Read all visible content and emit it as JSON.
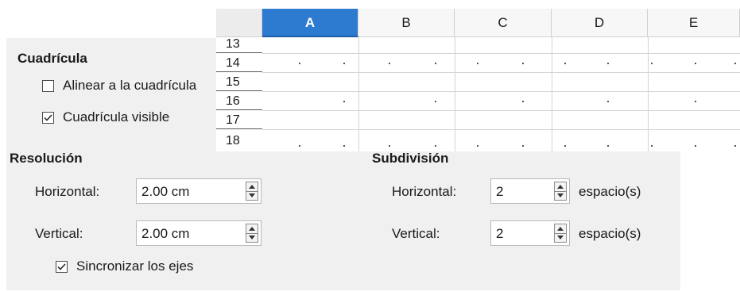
{
  "grid_section": {
    "title": "Cuadrícula",
    "snap_to_grid": {
      "label": "Alinear a la cuadrícula",
      "checked": false
    },
    "visible_grid": {
      "label": "Cuadrícula visible",
      "checked": true
    }
  },
  "resolution_section": {
    "title": "Resolución",
    "horizontal": {
      "label": "Horizontal:",
      "value": "2.00 cm"
    },
    "vertical": {
      "label": "Vertical:",
      "value": "2.00 cm"
    },
    "sync_axes": {
      "label": "Sincronizar los ejes",
      "checked": true
    }
  },
  "subdivision_section": {
    "title": "Subdivisión",
    "horizontal": {
      "label": "Horizontal:",
      "value": "2",
      "unit": "espacio(s)"
    },
    "vertical": {
      "label": "Vertical:",
      "value": "2",
      "unit": "espacio(s)"
    }
  },
  "spreadsheet": {
    "columns": [
      "A",
      "B",
      "C",
      "D",
      "E"
    ],
    "selected_column": "A",
    "rows": [
      "13",
      "14",
      "15",
      "16",
      "17",
      "18"
    ]
  }
}
